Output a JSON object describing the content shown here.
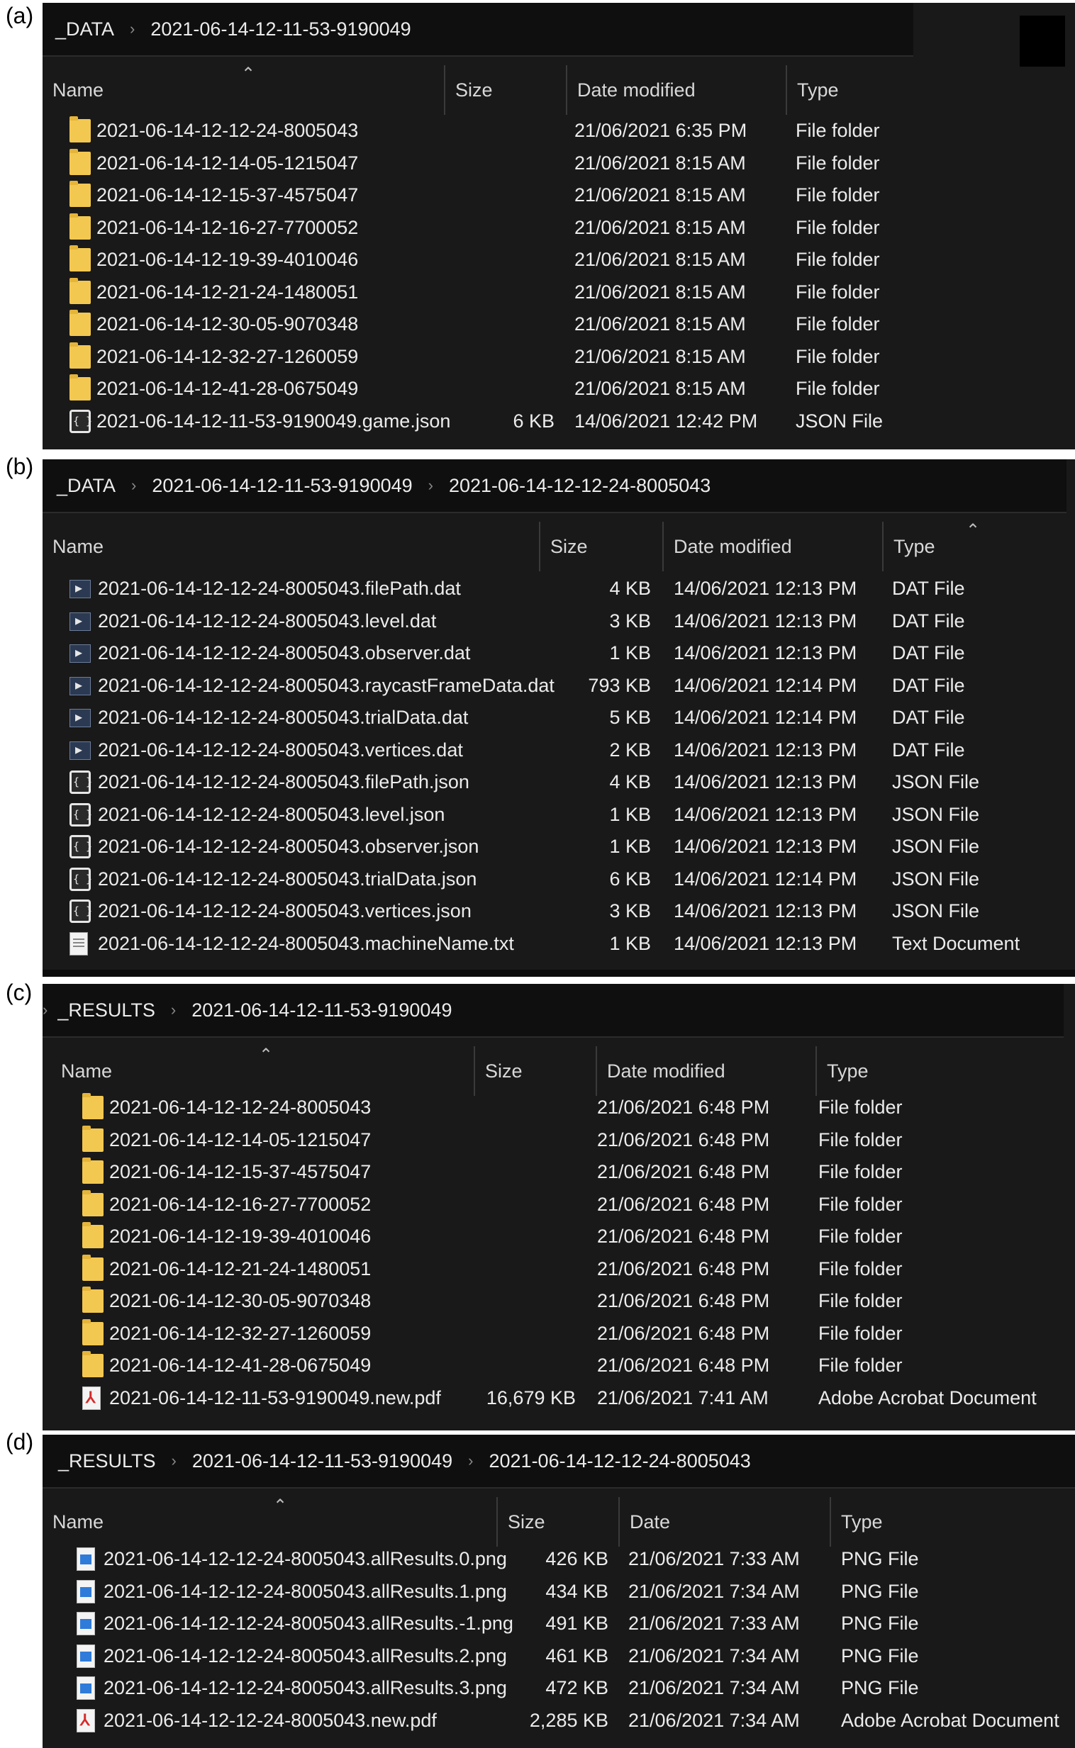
{
  "panels": [
    {
      "label": "(a)",
      "breadcrumb": [
        "_DATA",
        "2021-06-14-12-11-53-9190049"
      ],
      "columns": {
        "name": "Name",
        "size": "Size",
        "date": "Date modified",
        "type": "Type"
      },
      "rows": [
        {
          "icon": "folder-icon",
          "name": "2021-06-14-12-12-24-8005043",
          "size": "",
          "date": "21/06/2021 6:35 PM",
          "type": "File folder"
        },
        {
          "icon": "folder-icon",
          "name": "2021-06-14-12-14-05-1215047",
          "size": "",
          "date": "21/06/2021 8:15 AM",
          "type": "File folder"
        },
        {
          "icon": "folder-icon",
          "name": "2021-06-14-12-15-37-4575047",
          "size": "",
          "date": "21/06/2021 8:15 AM",
          "type": "File folder"
        },
        {
          "icon": "folder-icon",
          "name": "2021-06-14-12-16-27-7700052",
          "size": "",
          "date": "21/06/2021 8:15 AM",
          "type": "File folder"
        },
        {
          "icon": "folder-icon",
          "name": "2021-06-14-12-19-39-4010046",
          "size": "",
          "date": "21/06/2021 8:15 AM",
          "type": "File folder"
        },
        {
          "icon": "folder-icon",
          "name": "2021-06-14-12-21-24-1480051",
          "size": "",
          "date": "21/06/2021 8:15 AM",
          "type": "File folder"
        },
        {
          "icon": "folder-icon",
          "name": "2021-06-14-12-30-05-9070348",
          "size": "",
          "date": "21/06/2021 8:15 AM",
          "type": "File folder"
        },
        {
          "icon": "folder-icon",
          "name": "2021-06-14-12-32-27-1260059",
          "size": "",
          "date": "21/06/2021 8:15 AM",
          "type": "File folder"
        },
        {
          "icon": "folder-icon",
          "name": "2021-06-14-12-41-28-0675049",
          "size": "",
          "date": "21/06/2021 8:15 AM",
          "type": "File folder"
        },
        {
          "icon": "json-file-icon",
          "name": "2021-06-14-12-11-53-9190049.game.json",
          "size": "6 KB",
          "date": "14/06/2021 12:42 PM",
          "type": "JSON File"
        }
      ]
    },
    {
      "label": "(b)",
      "breadcrumb": [
        "_DATA",
        "2021-06-14-12-11-53-9190049",
        "2021-06-14-12-12-24-8005043"
      ],
      "columns": {
        "name": "Name",
        "size": "Size",
        "date": "Date modified",
        "type": "Type"
      },
      "rows": [
        {
          "icon": "dat-file-icon",
          "name": "2021-06-14-12-12-24-8005043.filePath.dat",
          "size": "4 KB",
          "date": "14/06/2021 12:13 PM",
          "type": "DAT File"
        },
        {
          "icon": "dat-file-icon",
          "name": "2021-06-14-12-12-24-8005043.level.dat",
          "size": "3 KB",
          "date": "14/06/2021 12:13 PM",
          "type": "DAT File"
        },
        {
          "icon": "dat-file-icon",
          "name": "2021-06-14-12-12-24-8005043.observer.dat",
          "size": "1 KB",
          "date": "14/06/2021 12:13 PM",
          "type": "DAT File"
        },
        {
          "icon": "dat-file-icon",
          "name": "2021-06-14-12-12-24-8005043.raycastFrameData.dat",
          "size": "793 KB",
          "date": "14/06/2021 12:14 PM",
          "type": "DAT File"
        },
        {
          "icon": "dat-file-icon",
          "name": "2021-06-14-12-12-24-8005043.trialData.dat",
          "size": "5 KB",
          "date": "14/06/2021 12:14 PM",
          "type": "DAT File"
        },
        {
          "icon": "dat-file-icon",
          "name": "2021-06-14-12-12-24-8005043.vertices.dat",
          "size": "2 KB",
          "date": "14/06/2021 12:13 PM",
          "type": "DAT File"
        },
        {
          "icon": "json-file-icon",
          "name": "2021-06-14-12-12-24-8005043.filePath.json",
          "size": "4 KB",
          "date": "14/06/2021 12:13 PM",
          "type": "JSON File"
        },
        {
          "icon": "json-file-icon",
          "name": "2021-06-14-12-12-24-8005043.level.json",
          "size": "1 KB",
          "date": "14/06/2021 12:13 PM",
          "type": "JSON File"
        },
        {
          "icon": "json-file-icon",
          "name": "2021-06-14-12-12-24-8005043.observer.json",
          "size": "1 KB",
          "date": "14/06/2021 12:13 PM",
          "type": "JSON File"
        },
        {
          "icon": "json-file-icon",
          "name": "2021-06-14-12-12-24-8005043.trialData.json",
          "size": "6 KB",
          "date": "14/06/2021 12:14 PM",
          "type": "JSON File"
        },
        {
          "icon": "json-file-icon",
          "name": "2021-06-14-12-12-24-8005043.vertices.json",
          "size": "3 KB",
          "date": "14/06/2021 12:13 PM",
          "type": "JSON File"
        },
        {
          "icon": "text-file-icon",
          "name": "2021-06-14-12-12-24-8005043.machineName.txt",
          "size": "1 KB",
          "date": "14/06/2021 12:13 PM",
          "type": "Text Document"
        }
      ]
    },
    {
      "label": "(c)",
      "breadcrumb": [
        "_RESULTS",
        "2021-06-14-12-11-53-9190049"
      ],
      "columns": {
        "name": "Name",
        "size": "Size",
        "date": "Date modified",
        "type": "Type"
      },
      "rows": [
        {
          "icon": "folder-icon",
          "name": "2021-06-14-12-12-24-8005043",
          "size": "",
          "date": "21/06/2021 6:48 PM",
          "type": "File folder"
        },
        {
          "icon": "folder-icon",
          "name": "2021-06-14-12-14-05-1215047",
          "size": "",
          "date": "21/06/2021 6:48 PM",
          "type": "File folder"
        },
        {
          "icon": "folder-icon",
          "name": "2021-06-14-12-15-37-4575047",
          "size": "",
          "date": "21/06/2021 6:48 PM",
          "type": "File folder"
        },
        {
          "icon": "folder-icon",
          "name": "2021-06-14-12-16-27-7700052",
          "size": "",
          "date": "21/06/2021 6:48 PM",
          "type": "File folder"
        },
        {
          "icon": "folder-icon",
          "name": "2021-06-14-12-19-39-4010046",
          "size": "",
          "date": "21/06/2021 6:48 PM",
          "type": "File folder"
        },
        {
          "icon": "folder-icon",
          "name": "2021-06-14-12-21-24-1480051",
          "size": "",
          "date": "21/06/2021 6:48 PM",
          "type": "File folder"
        },
        {
          "icon": "folder-icon",
          "name": "2021-06-14-12-30-05-9070348",
          "size": "",
          "date": "21/06/2021 6:48 PM",
          "type": "File folder"
        },
        {
          "icon": "folder-icon",
          "name": "2021-06-14-12-32-27-1260059",
          "size": "",
          "date": "21/06/2021 6:48 PM",
          "type": "File folder"
        },
        {
          "icon": "folder-icon",
          "name": "2021-06-14-12-41-28-0675049",
          "size": "",
          "date": "21/06/2021 6:48 PM",
          "type": "File folder"
        },
        {
          "icon": "pdf-file-icon",
          "name": "2021-06-14-12-11-53-9190049.new.pdf",
          "size": "16,679 KB",
          "date": "21/06/2021 7:41 AM",
          "type": "Adobe Acrobat Document"
        }
      ]
    },
    {
      "label": "(d)",
      "breadcrumb": [
        "_RESULTS",
        "2021-06-14-12-11-53-9190049",
        "2021-06-14-12-12-24-8005043"
      ],
      "columns": {
        "name": "Name",
        "size": "Size",
        "date": "Date",
        "type": "Type"
      },
      "rows": [
        {
          "icon": "png-file-icon",
          "name": "2021-06-14-12-12-24-8005043.allResults.0.png",
          "size": "426 KB",
          "date": "21/06/2021 7:33 AM",
          "type": "PNG File"
        },
        {
          "icon": "png-file-icon",
          "name": "2021-06-14-12-12-24-8005043.allResults.1.png",
          "size": "434 KB",
          "date": "21/06/2021 7:34 AM",
          "type": "PNG File"
        },
        {
          "icon": "png-file-icon",
          "name": "2021-06-14-12-12-24-8005043.allResults.-1.png",
          "size": "491 KB",
          "date": "21/06/2021 7:33 AM",
          "type": "PNG File"
        },
        {
          "icon": "png-file-icon",
          "name": "2021-06-14-12-12-24-8005043.allResults.2.png",
          "size": "461 KB",
          "date": "21/06/2021 7:34 AM",
          "type": "PNG File"
        },
        {
          "icon": "png-file-icon",
          "name": "2021-06-14-12-12-24-8005043.allResults.3.png",
          "size": "472 KB",
          "date": "21/06/2021 7:34 AM",
          "type": "PNG File"
        },
        {
          "icon": "pdf-file-icon",
          "name": "2021-06-14-12-12-24-8005043.new.pdf",
          "size": "2,285 KB",
          "date": "21/06/2021 7:34 AM",
          "type": "Adobe Acrobat Document"
        }
      ]
    }
  ]
}
